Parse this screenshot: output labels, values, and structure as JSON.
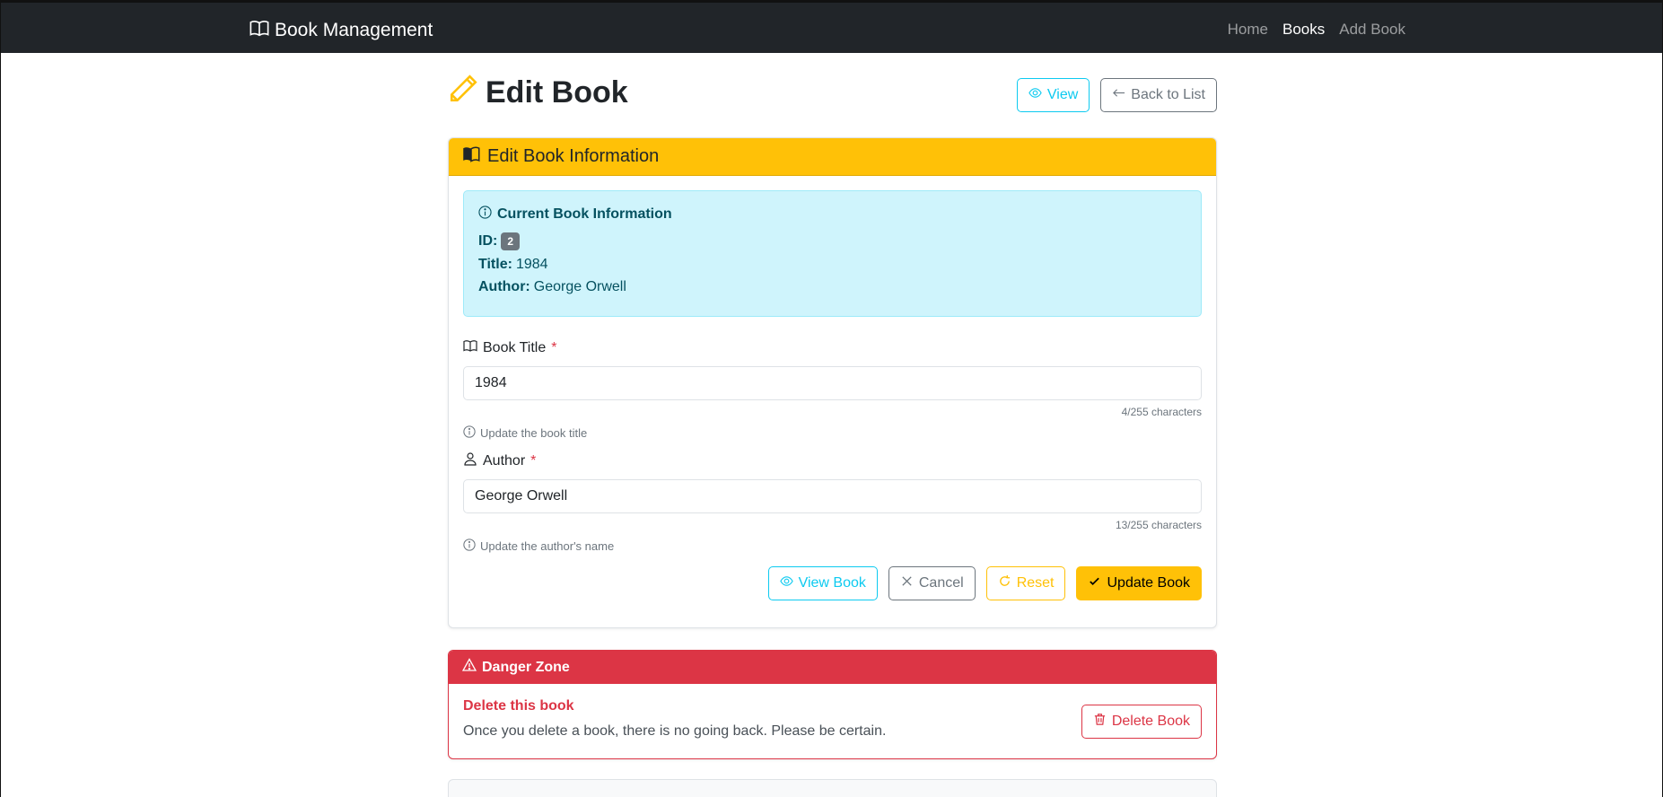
{
  "navbar": {
    "brand": "Book Management",
    "links": [
      "Home",
      "Books",
      "Add Book"
    ],
    "active": "Books"
  },
  "page": {
    "title": "Edit Book",
    "view_label": "View",
    "back_label": "Back to List"
  },
  "edit_card": {
    "header": "Edit Book Information",
    "current_info": {
      "title": "Current Book Information",
      "id_label": "ID:",
      "id_value": "2",
      "title_label": "Title:",
      "title_value": "1984",
      "author_label": "Author:",
      "author_value": "George Orwell"
    },
    "book_title": {
      "label": "Book Title",
      "required": "*",
      "value": "1984",
      "char_count": "4/255 characters",
      "help": "Update the book title"
    },
    "author": {
      "label": "Author",
      "required": "*",
      "value": "George Orwell",
      "char_count": "13/255 characters",
      "help": "Update the author's name"
    },
    "actions": {
      "view_book": "View Book",
      "cancel": "Cancel",
      "reset": "Reset",
      "update": "Update Book"
    }
  },
  "danger_zone": {
    "header": "Danger Zone",
    "title": "Delete this book",
    "text": "Once you delete a book, there is no going back. Please be certain.",
    "delete_label": "Delete Book"
  },
  "colors": {
    "navbar_bg": "#212529",
    "warning": "#ffc107",
    "info": "#0dcaf0",
    "danger": "#dc3545",
    "secondary": "#6c757d"
  },
  "icons": {
    "brand": "book-icon",
    "title": "pencil-icon",
    "view": "eye-icon",
    "back": "arrow-left-icon",
    "card_header": "book-half-icon",
    "info": "info-circle-icon",
    "author": "person-icon",
    "cancel": "x-icon",
    "reset": "refresh-icon",
    "update": "check-icon",
    "danger": "warning-triangle-icon",
    "delete": "trash-icon"
  }
}
